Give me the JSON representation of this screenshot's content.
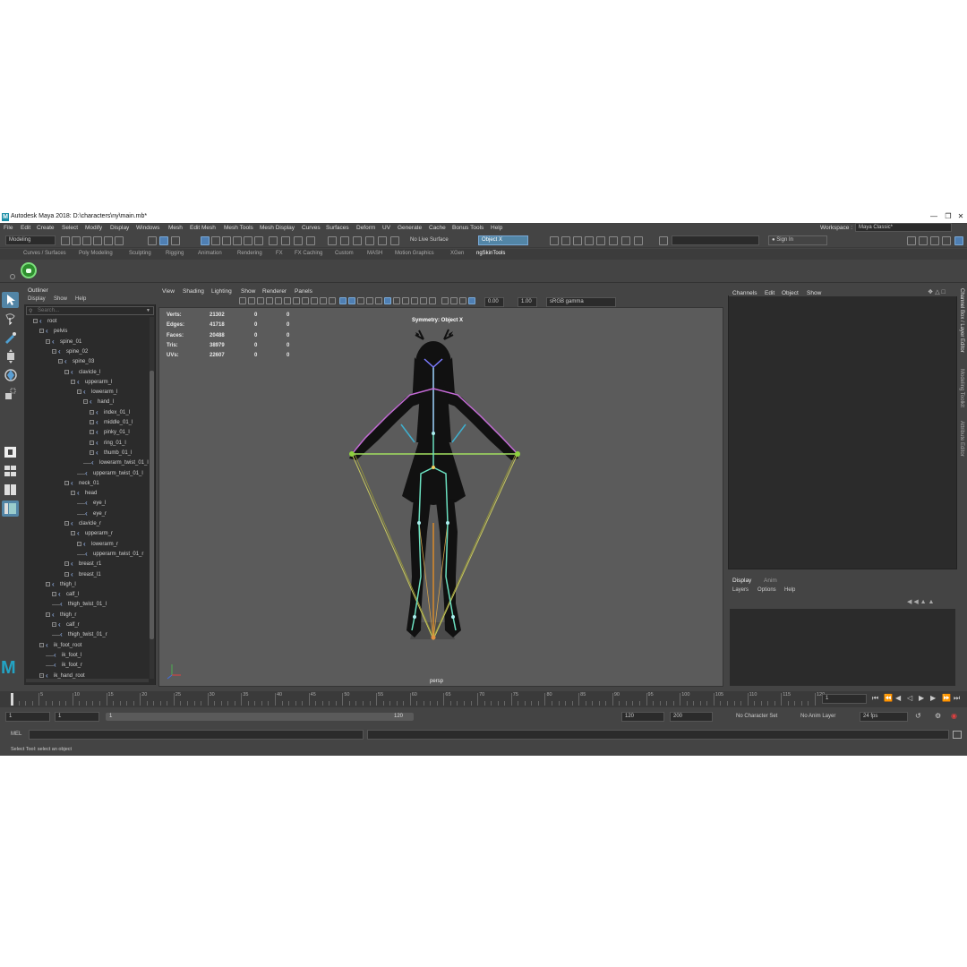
{
  "window": {
    "title": "Autodesk Maya 2018: D:\\characters\\ny\\main.mb*",
    "logo": "M",
    "minimize": "—",
    "restore": "❐",
    "close": "✕"
  },
  "menubar": {
    "items": [
      "File",
      "Edit",
      "Create",
      "Select",
      "Modify",
      "Display",
      "Windows",
      "Mesh",
      "Edit Mesh",
      "Mesh Tools",
      "Mesh Display",
      "Curves",
      "Surfaces",
      "Deform",
      "UV",
      "Generate",
      "Cache",
      "Bonus Tools",
      "Help"
    ]
  },
  "workspace": {
    "label": "Workspace :",
    "value": "Maya Classic*"
  },
  "toolbar": {
    "mode": "Modeling",
    "live_surface": "No Live Surface",
    "symmetry": "Object X",
    "sign_in": "Sign In"
  },
  "shelf": {
    "tabs": [
      "Curves / Surfaces",
      "Poly Modeling",
      "Sculpting",
      "Rigging",
      "Animation",
      "Rendering",
      "FX",
      "FX Caching",
      "Custom",
      "MASH",
      "Motion Graphics",
      "XGen",
      "ngSkinTools"
    ],
    "active": "ngSkinTools"
  },
  "outliner": {
    "title": "Outliner",
    "menu": [
      "Display",
      "Show",
      "Help"
    ],
    "search_placeholder": "Search...",
    "items": [
      {
        "label": "root",
        "depth": 0,
        "exp": true
      },
      {
        "label": "pelvis",
        "depth": 1,
        "exp": true
      },
      {
        "label": "spine_01",
        "depth": 2,
        "exp": true
      },
      {
        "label": "spine_02",
        "depth": 3,
        "exp": true
      },
      {
        "label": "spine_03",
        "depth": 4,
        "exp": true
      },
      {
        "label": "clavicle_l",
        "depth": 5,
        "exp": true
      },
      {
        "label": "upperarm_l",
        "depth": 6,
        "exp": true
      },
      {
        "label": "lowerarm_l",
        "depth": 7,
        "exp": true
      },
      {
        "label": "hand_l",
        "depth": 8,
        "exp": true
      },
      {
        "label": "index_01_l",
        "depth": 9,
        "exp": true
      },
      {
        "label": "middle_01_l",
        "depth": 9,
        "exp": true
      },
      {
        "label": "pinky_01_l",
        "depth": 9,
        "exp": true
      },
      {
        "label": "ring_01_l",
        "depth": 9,
        "exp": true
      },
      {
        "label": "thumb_01_l",
        "depth": 9,
        "exp": true
      },
      {
        "label": "lowerarm_twist_01_l",
        "depth": 8,
        "exp": false
      },
      {
        "label": "upperarm_twist_01_l",
        "depth": 7,
        "exp": false
      },
      {
        "label": "neck_01",
        "depth": 5,
        "exp": true
      },
      {
        "label": "head",
        "depth": 6,
        "exp": true
      },
      {
        "label": "eye_l",
        "depth": 7,
        "exp": false
      },
      {
        "label": "eye_r",
        "depth": 7,
        "exp": false
      },
      {
        "label": "clavicle_r",
        "depth": 5,
        "exp": true
      },
      {
        "label": "upperarm_r",
        "depth": 6,
        "exp": true
      },
      {
        "label": "lowerarm_r",
        "depth": 7,
        "exp": true
      },
      {
        "label": "upperarm_twist_01_r",
        "depth": 7,
        "exp": false
      },
      {
        "label": "breast_r1",
        "depth": 5,
        "exp": true
      },
      {
        "label": "breast_l1",
        "depth": 5,
        "exp": true
      },
      {
        "label": "thigh_l",
        "depth": 2,
        "exp": true
      },
      {
        "label": "calf_l",
        "depth": 3,
        "exp": true
      },
      {
        "label": "thigh_twist_01_l",
        "depth": 3,
        "exp": false
      },
      {
        "label": "thigh_r",
        "depth": 2,
        "exp": true
      },
      {
        "label": "calf_r",
        "depth": 3,
        "exp": true
      },
      {
        "label": "thigh_twist_01_r",
        "depth": 3,
        "exp": false
      },
      {
        "label": "ik_foot_root",
        "depth": 1,
        "exp": true
      },
      {
        "label": "ik_foot_l",
        "depth": 2,
        "exp": false
      },
      {
        "label": "ik_foot_r",
        "depth": 2,
        "exp": false
      },
      {
        "label": "ik_hand_root",
        "depth": 1,
        "exp": true
      }
    ]
  },
  "viewport": {
    "menu": [
      "View",
      "Shading",
      "Lighting",
      "Show",
      "Renderer",
      "Panels"
    ],
    "exposure": "0.00",
    "gamma": "1.00",
    "color_space": "sRGB gamma",
    "symmetry_label": "Symmetry: Object X",
    "camera": "persp",
    "hud": [
      {
        "label": "Verts:",
        "total": "21302",
        "sel": "0",
        "comp": "0"
      },
      {
        "label": "Edges:",
        "total": "41718",
        "sel": "0",
        "comp": "0"
      },
      {
        "label": "Faces:",
        "total": "20488",
        "sel": "0",
        "comp": "0"
      },
      {
        "label": "Tris:",
        "total": "38979",
        "sel": "0",
        "comp": "0"
      },
      {
        "label": "UVs:",
        "total": "22607",
        "sel": "0",
        "comp": "0"
      }
    ]
  },
  "channel_box": {
    "menu": [
      "Channels",
      "Edit",
      "Object",
      "Show"
    ]
  },
  "layer_editor": {
    "tabs": [
      "Display",
      "Anim"
    ],
    "menu": [
      "Layers",
      "Options",
      "Help"
    ]
  },
  "side_tabs": [
    "Channel Box / Layer Editor",
    "Modeling Toolkit",
    "Attribute Editor"
  ],
  "timeline": {
    "ticks": [
      "5",
      "10",
      "15",
      "20",
      "25",
      "30",
      "35",
      "40",
      "45",
      "50",
      "55",
      "60",
      "65",
      "70",
      "75",
      "80",
      "85",
      "90",
      "95",
      "100",
      "105",
      "110",
      "115",
      "120"
    ],
    "current_frame": "1"
  },
  "range": {
    "start": "1",
    "playback_start": "1",
    "slider_start": "1",
    "slider_end": "120",
    "playback_end": "120",
    "end": "200",
    "character_set": "No Character Set",
    "anim_layer": "No Anim Layer",
    "fps": "24 fps"
  },
  "command_line": {
    "mode": "MEL"
  },
  "help_line": {
    "text": "Select Tool: select an object"
  },
  "colors": {
    "selection_blue": "#5285a6",
    "panel_dark": "#2b2b2b",
    "ui_grey": "#444444",
    "viewport_bg": "#5b5b5b"
  }
}
